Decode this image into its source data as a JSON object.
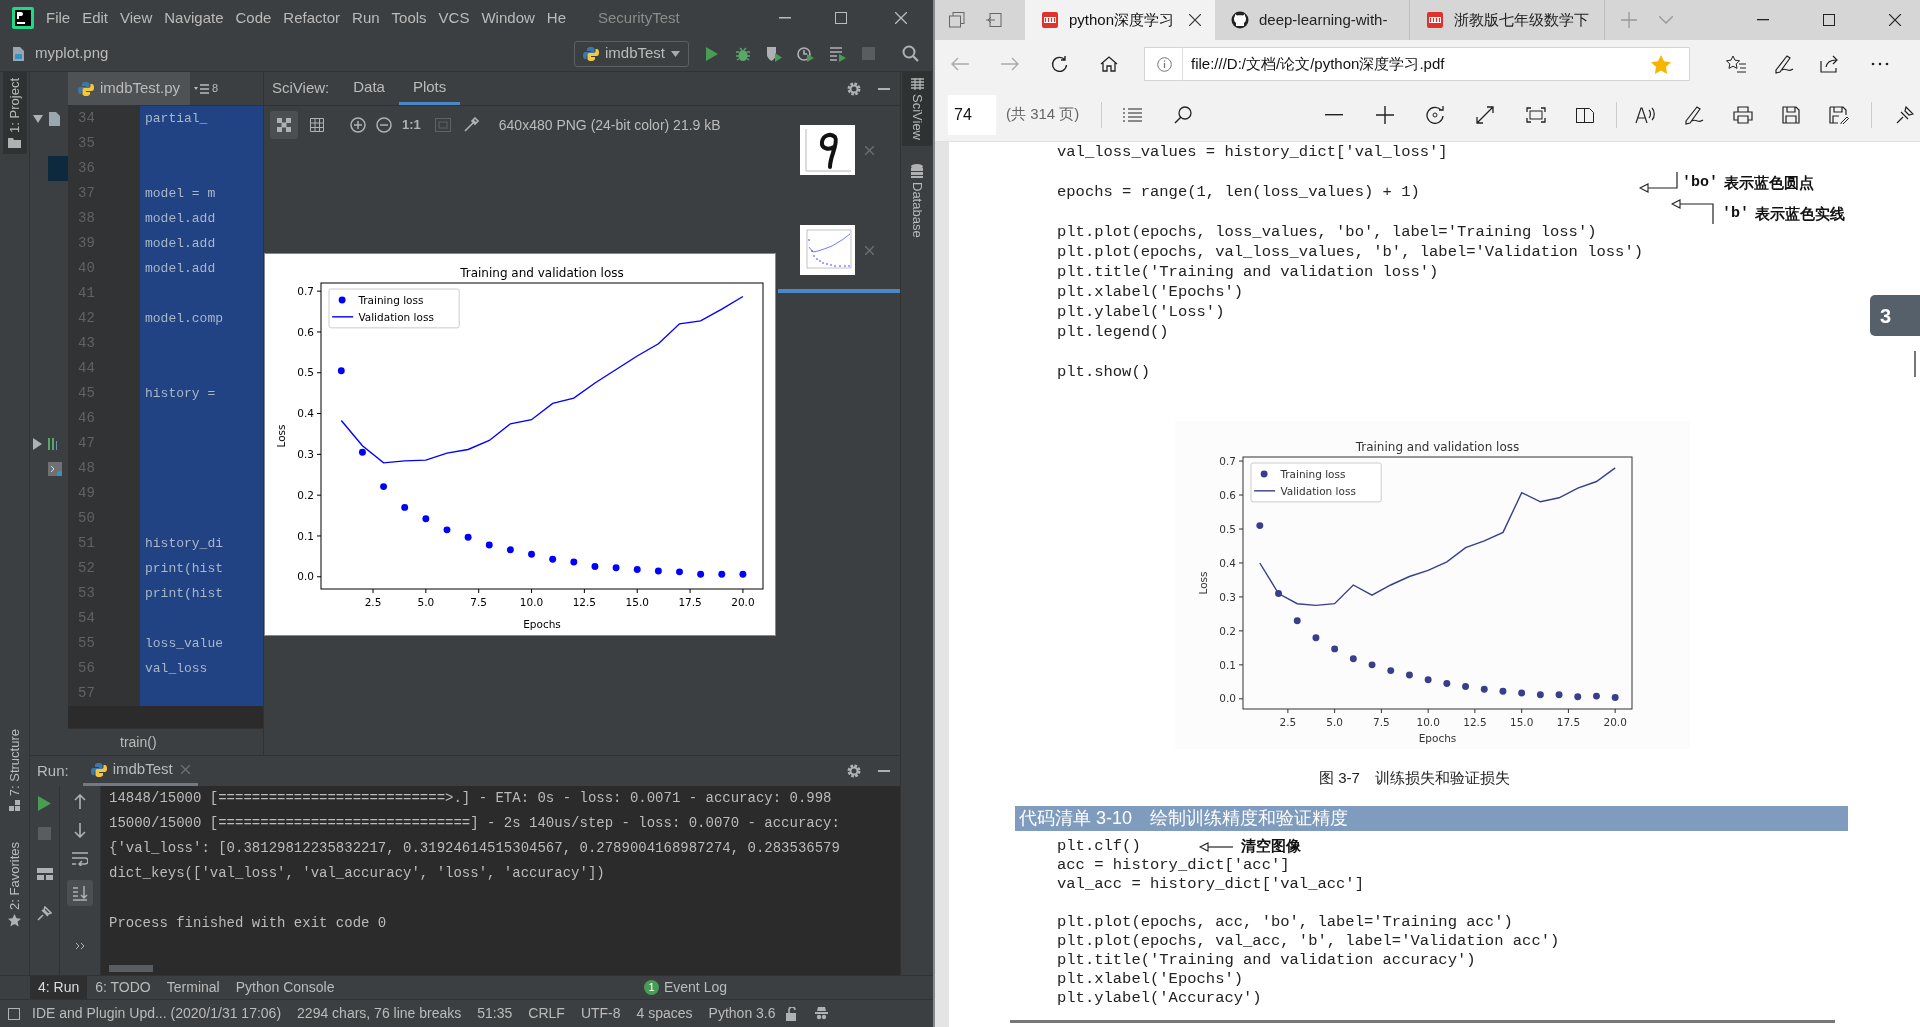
{
  "ide": {
    "menu": [
      "File",
      "Edit",
      "View",
      "Navigate",
      "Code",
      "Refactor",
      "Run",
      "Tools",
      "VCS",
      "Window",
      "He"
    ],
    "window_title": "SecurityTest",
    "open_file": "myplot.png",
    "run_config": "imdbTest",
    "tool_windows": {
      "left_top": "1: Project",
      "left_middle": "7: Structure",
      "left_bottom": "2: Favorites",
      "right": [
        "SciView",
        "Database"
      ]
    },
    "editor": {
      "tab": "imdbTest.py",
      "tab_count": "8",
      "breadcrumb": "train()",
      "lines": [
        {
          "number": "34",
          "code": "partial_"
        },
        {
          "number": "35"
        },
        {
          "number": "36"
        },
        {
          "number": "37",
          "code": "model = m"
        },
        {
          "number": "38",
          "code": "model.add"
        },
        {
          "number": "39",
          "code": "model.add"
        },
        {
          "number": "40",
          "code": "model.add"
        },
        {
          "number": "41"
        },
        {
          "number": "42",
          "code": "model.comp"
        },
        {
          "number": "43"
        },
        {
          "number": "44"
        },
        {
          "number": "45",
          "code": "history ="
        },
        {
          "number": "46"
        },
        {
          "number": "47"
        },
        {
          "number": "48"
        },
        {
          "number": "49"
        },
        {
          "number": "50"
        },
        {
          "number": "51",
          "code": "history_di"
        },
        {
          "number": "52",
          "code": "print(hist"
        },
        {
          "number": "53",
          "code": "print(hist"
        },
        {
          "number": "54"
        },
        {
          "number": "55",
          "code": "loss_value"
        },
        {
          "number": "56",
          "code": "val_loss"
        },
        {
          "number": "57"
        }
      ]
    },
    "sciview": {
      "label": "SciView:",
      "tabs": [
        {
          "label": "Data",
          "selected": false
        },
        {
          "label": "Plots",
          "selected": true
        }
      ],
      "actual_size": "1:1",
      "image_info": "640x480 PNG (24-bit color) 21.9 kB",
      "plot": {
        "chart_data": {
          "type": "line",
          "title": "Training and validation loss",
          "xlabel": "Epochs",
          "ylabel": "Loss",
          "x": [
            1,
            2,
            3,
            4,
            5,
            6,
            7,
            8,
            9,
            10,
            11,
            12,
            13,
            14,
            15,
            16,
            17,
            18,
            19,
            20
          ],
          "series": [
            {
              "name": "Training loss",
              "type": "scatter",
              "marker": "circle",
              "color": "#0000ff",
              "values": [
                0.505,
                0.305,
                0.221,
                0.17,
                0.142,
                0.115,
                0.097,
                0.078,
                0.066,
                0.055,
                0.043,
                0.036,
                0.025,
                0.022,
                0.018,
                0.014,
                0.012,
                0.006,
                0.006,
                0.006
              ]
            },
            {
              "name": "Validation loss",
              "type": "line",
              "color": "#0000ff",
              "values": [
                0.383,
                0.321,
                0.279,
                0.284,
                0.286,
                0.303,
                0.312,
                0.334,
                0.375,
                0.385,
                0.425,
                0.438,
                0.475,
                0.508,
                0.541,
                0.571,
                0.62,
                0.627,
                0.656,
                0.687
              ]
            }
          ],
          "legend": "upper left",
          "xlim": [
            0.04,
            20.95
          ],
          "ylim": [
            -0.03,
            0.72
          ],
          "xticks": [
            {
              "value": 2.5,
              "label": "2.5"
            },
            {
              "value": 5,
              "label": "5.0"
            },
            {
              "value": 7.5,
              "label": "7.5"
            },
            {
              "value": 10,
              "label": "10.0"
            },
            {
              "value": 12.5,
              "label": "12.5"
            },
            {
              "value": 15,
              "label": "15.0"
            },
            {
              "value": 17.5,
              "label": "17.5"
            },
            {
              "value": 20,
              "label": "20.0"
            }
          ],
          "yticks": [
            {
              "value": 0,
              "label": "0.0"
            },
            {
              "value": 0.1,
              "label": "0.1"
            },
            {
              "value": 0.2,
              "label": "0.2"
            },
            {
              "value": 0.3,
              "label": "0.3"
            },
            {
              "value": 0.4,
              "label": "0.4"
            },
            {
              "value": 0.5,
              "label": "0.5"
            },
            {
              "value": 0.6,
              "label": "0.6"
            },
            {
              "value": 0.7,
              "label": "0.7"
            }
          ]
        }
      }
    },
    "run": {
      "label": "Run:",
      "tab": "imdbTest",
      "console": [
        [
          "14848/15000 [===========================>.] - ETA: 0s - loss: 0.0071 - accuracy: 0.998",
          "15000/15000 [==============================] - 2s 140us/step - loss: 0.0070 - accuracy:",
          "{'val_loss': [0.38129812235832217, 0.31924614515304567, 0.2789004168987274, 0.283536579",
          "dict_keys(['val_loss', 'val_accuracy', 'loss', 'accuracy'])"
        ],
        [
          "Process finished with exit code 0"
        ]
      ]
    },
    "tool_tabs": [
      {
        "label": "4: Run",
        "selected": true
      },
      {
        "label": "6: TODO",
        "selected": false
      },
      {
        "label": "Terminal",
        "selected": false
      },
      {
        "label": "Python Console",
        "selected": false
      }
    ],
    "event_log": {
      "label": "Event Log",
      "count": "1"
    },
    "status_bar": [
      "IDE and Plugin Upd... (2020/1/31 17:06)",
      "2294 chars, 76 line breaks",
      "51:35",
      "CRLF",
      "UTF-8",
      "4 spaces",
      "Python 3.6"
    ]
  },
  "browser": {
    "tabs": [
      {
        "title": "python深度学习",
        "kind": "pdf",
        "selected": true
      },
      {
        "title": "deep-learning-with-",
        "kind": "github",
        "selected": false
      },
      {
        "title": "浙教版七年级数学下",
        "kind": "pdf",
        "selected": false
      }
    ],
    "address": "file:///D:/文档/论文/python深度学习.pdf",
    "page_number": "74",
    "page_count": "(共 314 页)",
    "chapter_tab": "3",
    "listing_1": [
      [
        "val_loss_values = history_dict['val_loss']"
      ],
      [
        "epochs = range(1, len(loss_values) + 1)"
      ],
      [
        "plt.plot(epochs, loss_values, 'bo', label='Training loss')",
        "plt.plot(epochs, val_loss_values, 'b', label='Validation loss')",
        "plt.title('Training and validation loss')",
        "plt.xlabel('Epochs')",
        "plt.ylabel('Loss')",
        "plt.legend()"
      ],
      [
        "plt.show()"
      ]
    ],
    "annotations": [
      {
        "code": "'bo'",
        "text": "表示蓝色圆点"
      },
      {
        "code": "'b'",
        "text": "表示蓝色实线"
      }
    ],
    "figure": {
      "caption": "图 3-7　训练损失和验证损失",
      "chart_data": {
        "type": "line",
        "title": "Training and validation loss",
        "xlabel": "Epochs",
        "ylabel": "Loss",
        "x": [
          1,
          2,
          3,
          4,
          5,
          6,
          7,
          8,
          9,
          10,
          11,
          12,
          13,
          14,
          15,
          16,
          17,
          18,
          19,
          20
        ],
        "series": [
          {
            "name": "Training loss",
            "type": "scatter",
            "marker": "circle",
            "color": "#383e8c",
            "values": [
              0.51,
              0.31,
              0.23,
              0.18,
              0.147,
              0.118,
              0.1,
              0.083,
              0.07,
              0.056,
              0.045,
              0.036,
              0.028,
              0.022,
              0.017,
              0.012,
              0.012,
              0.006,
              0.008,
              0.004
            ]
          },
          {
            "name": "Validation loss",
            "type": "line",
            "color": "#383e8c",
            "values": [
              0.4,
              0.31,
              0.28,
              0.275,
              0.28,
              0.335,
              0.305,
              0.335,
              0.36,
              0.378,
              0.403,
              0.445,
              0.465,
              0.49,
              0.607,
              0.58,
              0.592,
              0.62,
              0.64,
              0.68
            ]
          }
        ],
        "legend": "upper left",
        "xlim": [
          0.1,
          20.9
        ],
        "ylim": [
          -0.03,
          0.712
        ],
        "xticks": [
          {
            "value": 2.5,
            "label": "2.5"
          },
          {
            "value": 5,
            "label": "5.0"
          },
          {
            "value": 7.5,
            "label": "7.5"
          },
          {
            "value": 10,
            "label": "10.0"
          },
          {
            "value": 12.5,
            "label": "12.5"
          },
          {
            "value": 15,
            "label": "15.0"
          },
          {
            "value": 17.5,
            "label": "17.5"
          },
          {
            "value": 20,
            "label": "20.0"
          }
        ],
        "yticks": [
          {
            "value": 0,
            "label": "0.0"
          },
          {
            "value": 0.1,
            "label": "0.1"
          },
          {
            "value": 0.2,
            "label": "0.2"
          },
          {
            "value": 0.3,
            "label": "0.3"
          },
          {
            "value": 0.4,
            "label": "0.4"
          },
          {
            "value": 0.5,
            "label": "0.5"
          },
          {
            "value": 0.6,
            "label": "0.6"
          },
          {
            "value": 0.7,
            "label": "0.7"
          }
        ]
      }
    },
    "listing_2": {
      "heading": "代码清单 3-10　绘制训练精度和验证精度",
      "clear_note": "清空图像",
      "lines": [
        [
          "plt.clf()",
          "acc = history_dict['acc']",
          "val_acc = history_dict['val_acc']"
        ],
        [
          "plt.plot(epochs, acc, 'bo', label='Training acc')",
          "plt.plot(epochs, val_acc, 'b', label='Validation acc')",
          "plt.title('Training and validation accuracy')",
          "plt.xlabel('Epochs')",
          "plt.ylabel('Accuracy')"
        ]
      ]
    }
  }
}
